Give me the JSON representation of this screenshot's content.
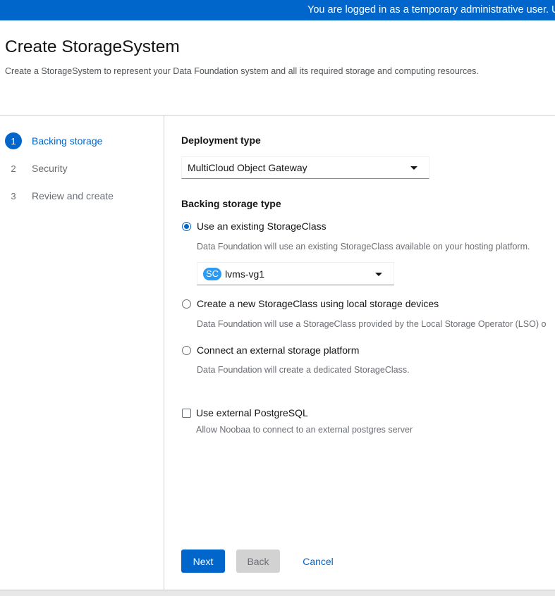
{
  "banner": {
    "text": "You are logged in as a temporary administrative user. Upd"
  },
  "header": {
    "title": "Create StorageSystem",
    "description": "Create a StorageSystem to represent your Data Foundation system and all its required storage and computing resources."
  },
  "wizard_nav": [
    {
      "number": "1",
      "label": "Backing storage",
      "active": true
    },
    {
      "number": "2",
      "label": "Security",
      "active": false
    },
    {
      "number": "3",
      "label": "Review and create",
      "active": false
    }
  ],
  "deployment": {
    "label": "Deployment type",
    "selected": "MultiCloud Object Gateway"
  },
  "backing_storage": {
    "label": "Backing storage type",
    "options": [
      {
        "label": "Use an existing StorageClass",
        "help": "Data Foundation will use an existing StorageClass available on your hosting platform.",
        "checked": true
      },
      {
        "label": "Create a new StorageClass using local storage devices",
        "help": "Data Foundation will use a StorageClass provided by the Local Storage Operator (LSO) o",
        "checked": false
      },
      {
        "label": "Connect an external storage platform",
        "help": "Data Foundation will create a dedicated StorageClass.",
        "checked": false
      }
    ],
    "storage_class": {
      "badge": "SC",
      "value": "lvms-vg1"
    }
  },
  "postgres": {
    "label": "Use external PostgreSQL",
    "help": "Allow Noobaa to connect to an external postgres server",
    "checked": false
  },
  "footer": {
    "next": "Next",
    "back": "Back",
    "cancel": "Cancel"
  },
  "colors": {
    "primary": "#0066cc",
    "badge": "#2b9af3"
  }
}
